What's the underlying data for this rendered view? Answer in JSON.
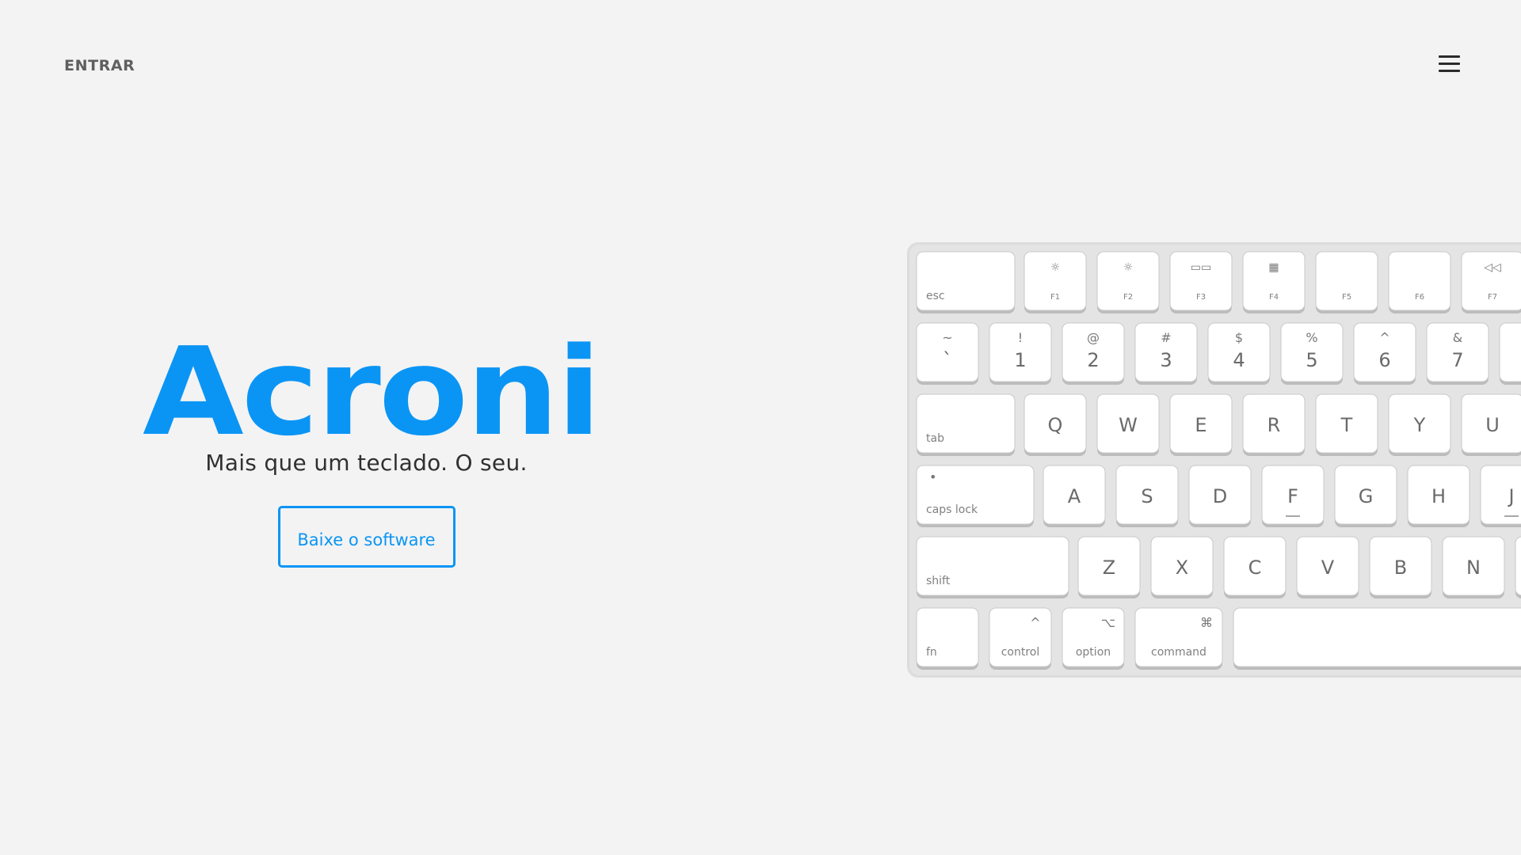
{
  "header": {
    "login_label": "ENTRAR",
    "menu_icon": "hamburger-menu-icon"
  },
  "hero": {
    "brand": "Acroni",
    "tagline": "Mais que um teclado. O seu.",
    "cta_label": "Baixe o software"
  },
  "colors": {
    "background": "#f3f3f3",
    "accent": "#0a95f5",
    "text": "#303030",
    "nav_text": "#5f5f5f"
  },
  "keyboard": {
    "rows": [
      [
        {
          "main": "",
          "top": "",
          "sub": "esc"
        },
        {
          "main": "",
          "top": "☼",
          "sub": "F1"
        },
        {
          "main": "",
          "top": "☼",
          "sub": "F2"
        },
        {
          "main": "",
          "top": "▭▭",
          "sub": "F3"
        },
        {
          "main": "",
          "top": "▦",
          "sub": "F4"
        },
        {
          "main": "",
          "top": "",
          "sub": "F5"
        },
        {
          "main": "",
          "top": "",
          "sub": "F6"
        },
        {
          "main": "",
          "top": "◁◁",
          "sub": "F7"
        }
      ],
      [
        {
          "main": "`",
          "top": "~",
          "sub": ""
        },
        {
          "main": "1",
          "top": "!",
          "sub": ""
        },
        {
          "main": "2",
          "top": "@",
          "sub": ""
        },
        {
          "main": "3",
          "top": "#",
          "sub": ""
        },
        {
          "main": "4",
          "top": "$",
          "sub": ""
        },
        {
          "main": "5",
          "top": "%",
          "sub": ""
        },
        {
          "main": "6",
          "top": "^",
          "sub": ""
        },
        {
          "main": "7",
          "top": "&",
          "sub": ""
        },
        {
          "main": "",
          "top": "",
          "sub": ""
        }
      ],
      [
        {
          "main": "",
          "top": "",
          "sub": "tab"
        },
        {
          "main": "Q",
          "top": "",
          "sub": ""
        },
        {
          "main": "W",
          "top": "",
          "sub": ""
        },
        {
          "main": "E",
          "top": "",
          "sub": ""
        },
        {
          "main": "R",
          "top": "",
          "sub": ""
        },
        {
          "main": "T",
          "top": "",
          "sub": ""
        },
        {
          "main": "Y",
          "top": "",
          "sub": ""
        },
        {
          "main": "U",
          "top": "",
          "sub": ""
        }
      ],
      [
        {
          "main": "",
          "top": "•",
          "sub": "caps lock"
        },
        {
          "main": "A",
          "top": "",
          "sub": ""
        },
        {
          "main": "S",
          "top": "",
          "sub": ""
        },
        {
          "main": "D",
          "top": "",
          "sub": ""
        },
        {
          "main": "F",
          "top": "",
          "sub": ""
        },
        {
          "main": "G",
          "top": "",
          "sub": ""
        },
        {
          "main": "H",
          "top": "",
          "sub": ""
        },
        {
          "main": "J",
          "top": "",
          "sub": ""
        }
      ],
      [
        {
          "main": "",
          "top": "",
          "sub": "shift"
        },
        {
          "main": "Z",
          "top": "",
          "sub": ""
        },
        {
          "main": "X",
          "top": "",
          "sub": ""
        },
        {
          "main": "C",
          "top": "",
          "sub": ""
        },
        {
          "main": "V",
          "top": "",
          "sub": ""
        },
        {
          "main": "B",
          "top": "",
          "sub": ""
        },
        {
          "main": "N",
          "top": "",
          "sub": ""
        },
        {
          "main": "",
          "top": "",
          "sub": ""
        }
      ],
      [
        {
          "main": "",
          "top": "",
          "sub": "fn"
        },
        {
          "main": "",
          "top": "^",
          "sub": "control"
        },
        {
          "main": "",
          "top": "⌥",
          "sub": "option"
        },
        {
          "main": "",
          "top": "⌘",
          "sub": "command"
        },
        {
          "main": "",
          "top": "",
          "sub": ""
        }
      ]
    ]
  }
}
